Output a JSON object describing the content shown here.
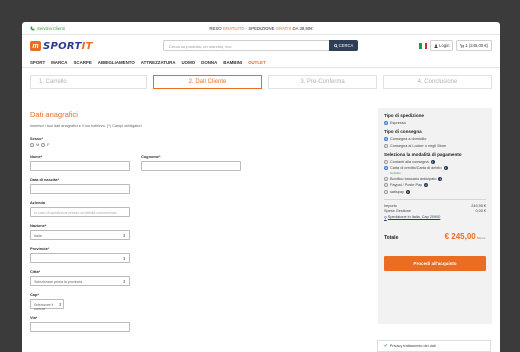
{
  "topbar": {
    "service_label": "Servizio Clienti",
    "promo_prefix": "RESO ",
    "promo_free1": "GRATUITO",
    "promo_mid": " · SPEDIZIONE ",
    "promo_free2": "GRATIS",
    "promo_suffix": " DA 39,90€"
  },
  "header": {
    "logo_mark": "m",
    "logo_word_a": "SPORT",
    "logo_word_b": "IT",
    "search_placeholder": "Cerca un prodotto, un marchio, ecc",
    "search_button": "CERCA",
    "login_label": "Login",
    "cart_label": "1 (245,00 €)"
  },
  "nav": {
    "items": [
      "SPORT",
      "MARCA",
      "SCARPE",
      "ABBIGLIAMENTO",
      "ATTREZZATURA",
      "UOMO",
      "DONNA",
      "BAMBINI"
    ],
    "outlet": "OUTLET"
  },
  "steps": [
    "1. Carrello",
    "2. Dati Cliente",
    "3. Pre-Conferma",
    "4. Conclusione"
  ],
  "form": {
    "title": "Dati anagrafici",
    "hint": "Inserisci i tuoi dati anagrafici e il tuo indirizzo. (*) Campi obbligatori",
    "sesso_label": "Sesso*",
    "sesso_m": "M",
    "sesso_f": "F",
    "nome_label": "Nome*",
    "cognome_label": "Cognome*",
    "nascita_label": "Data di nascita*",
    "azienda_label": "Azienda",
    "azienda_placeholder": "In caso di spedizione presso un'attività commerciale",
    "nazione_label": "Nazione*",
    "nazione_value": "Italia",
    "provincia_label": "Provincia*",
    "citta_label": "Città*",
    "citta_value": "Selezionare prima la provincia",
    "cap_label": "Cap*",
    "cap_value": "Selezionare il comune",
    "via_label": "Via*"
  },
  "sidebar": {
    "tipo_spedizione": "Tipo di spedizione",
    "espresso": "Espresso",
    "tipo_consegna": "Tipo di consegna",
    "consegna_domicilio": "Consegna a domicilio",
    "consegna_locker": "Consegna ai Locker o negli Store",
    "pagamento_title": "Seleziona la modalità di pagamento",
    "pay_contanti": "Contanti alla consegna",
    "pay_carta": "Carta di credito/Carta di debito",
    "pay_carta_sub": "Gratuito",
    "pay_bonifico": "Bonifico bancario anticipato",
    "pay_paypal": "Paypal / Poste Pay",
    "pay_satispay": "satispay",
    "importo_label": "Importo",
    "importo_value": "249,95 €",
    "spese_label": "Spese Gestione",
    "spese_value": "0,00 €",
    "spedizione_link": "Spedizione in Italia, Cap 20900",
    "totale_label": "Totale",
    "totale_value": "€ 245,00",
    "iva_label": "IVA inc.",
    "proceed_button": "Procedi all'acquisto",
    "privacy_label": "Privacy&nbsp;trattamento dei dati"
  },
  "colors": {
    "accent": "#ea6d22",
    "navy": "#2f3d55",
    "brand_blue": "#2a3b8f",
    "green": "#2e9e3e"
  }
}
